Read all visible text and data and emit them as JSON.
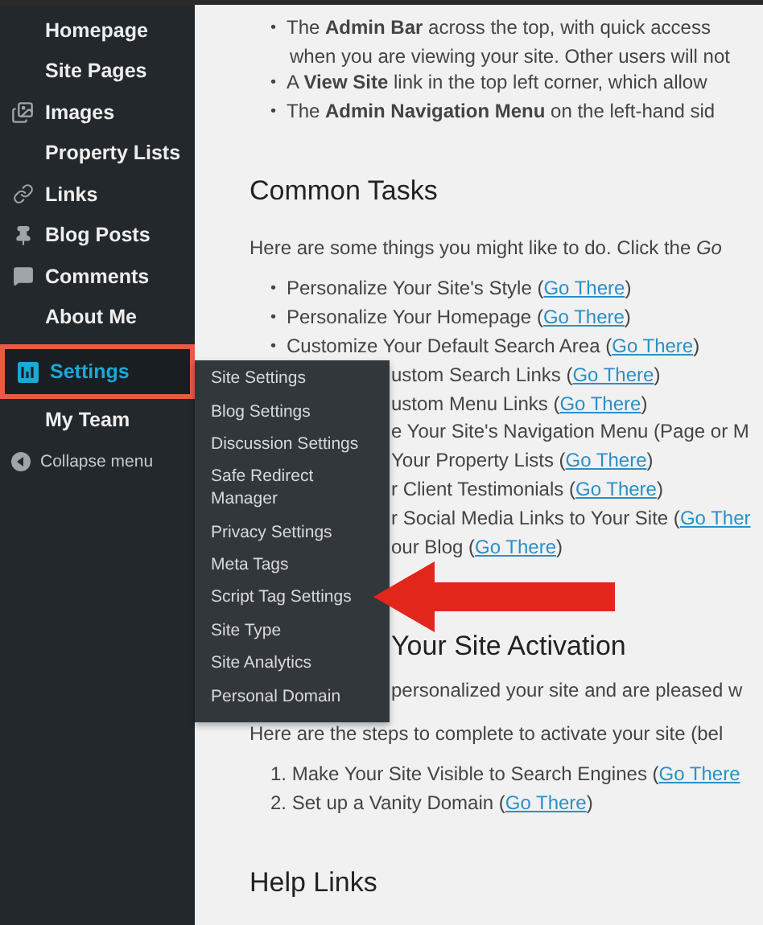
{
  "sidebar": {
    "items": [
      {
        "label": "Homepage",
        "selected": false
      },
      {
        "label": "Site Pages",
        "selected": false
      },
      {
        "label": "Images",
        "selected": false
      },
      {
        "label": "Property Lists",
        "selected": false
      },
      {
        "label": "Links",
        "selected": false
      },
      {
        "label": "Blog Posts",
        "selected": false
      },
      {
        "label": "Comments",
        "selected": false
      },
      {
        "label": "About Me",
        "selected": false
      },
      {
        "label": "Settings",
        "selected": true
      },
      {
        "label": "My Team",
        "selected": false
      }
    ],
    "collapse": "Collapse menu"
  },
  "submenu": {
    "items": [
      "Site Settings",
      "Blog Settings",
      "Discussion Settings",
      "Safe Redirect Manager",
      "Privacy Settings",
      "Meta Tags",
      "Script Tag Settings",
      "Site Type",
      "Site Analytics",
      "Personal Domain"
    ]
  },
  "content": [
    {
      "kind": "bullet",
      "bullet": "•",
      "text": "The **Admin Bar** across the top, with quick access",
      "more": "when you are viewing your site. Other users will not"
    },
    {
      "kind": "bullet",
      "bullet": "•",
      "text": "A **View Site** link in the top left corner, which allow"
    },
    {
      "kind": "bullet",
      "bullet": "•",
      "text": "The **Admin Navigation Menu** on the left-hand sid"
    },
    {
      "kind": "heading",
      "text": "Common Tasks"
    },
    {
      "kind": "paragraph",
      "text": "Here are some things you might like to do. Click the *Go*"
    },
    {
      "kind": "bullet",
      "bullet": "•",
      "text": "Personalize Your Site's Style (",
      "link": "Go There",
      "after": ")"
    },
    {
      "kind": "bullet",
      "bullet": "•",
      "text": "Personalize Your Homepage (",
      "link": "Go There",
      "after": ")"
    },
    {
      "kind": "bullet",
      "bullet": "•",
      "text": "Customize Your Default Search Area (",
      "link": "Go There",
      "after": ")"
    },
    {
      "kind": "partial",
      "text": "ustom Search Links (",
      "link": "Go There",
      "after": ")"
    },
    {
      "kind": "partial",
      "text": "ustom Menu Links (",
      "link": "Go There",
      "after": ")"
    },
    {
      "kind": "partial",
      "text": "e Your Site's Navigation Menu (Page or M"
    },
    {
      "kind": "partial",
      "text": "Your Property Lists (",
      "link": "Go There",
      "after": ")"
    },
    {
      "kind": "partial",
      "text": "r Client Testimonials (",
      "link": "Go There",
      "after": ")"
    },
    {
      "kind": "partial",
      "text": "r Social Media Links to Your Site (",
      "link": "Go Ther"
    },
    {
      "kind": "partial",
      "text": "our Blog (",
      "link": "Go There",
      "after": ")"
    },
    {
      "kind": "partial-heading",
      "text": "Your Site Activation"
    },
    {
      "kind": "partial",
      "text": "personalized your site and are pleased w"
    },
    {
      "kind": "paragraph",
      "text": "Here are the steps to complete to activate your site (bel"
    },
    {
      "kind": "numbered",
      "number": "1.",
      "text": "Make Your Site Visible to Search Engines (",
      "link": "Go There"
    },
    {
      "kind": "numbered",
      "number": "2.",
      "text": "Set up a Vanity Domain (",
      "link": "Go There",
      "after": ")"
    },
    {
      "kind": "heading",
      "text": "Help Links"
    }
  ]
}
